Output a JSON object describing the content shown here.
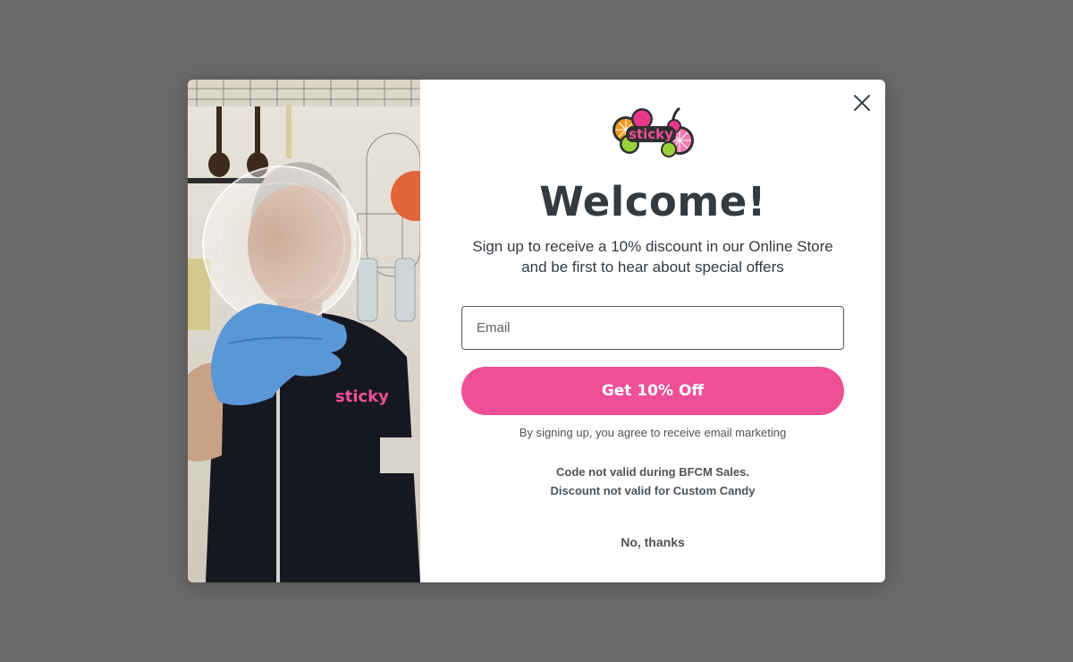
{
  "modal": {
    "logo_text": "sticky",
    "title": "Welcome!",
    "subtitle_line1": "Sign up to receive a 10% discount in our Online Store",
    "subtitle_line2": "and be first to hear about special offers",
    "email_placeholder": "Email",
    "email_value": "",
    "cta_label": "Get 10% Off",
    "consent_text": "By signing up, you agree to receive email marketing",
    "terms_line1": "Code not valid during BFCM Sales.",
    "terms_line2": "Discount not valid for Custom Candy",
    "decline_label": "No, thanks",
    "photo_shirt_text": "sticky",
    "close_icon": "close-icon"
  },
  "colors": {
    "overlay": "#6b6a69",
    "accent": "#ef4f96",
    "text": "#333a40"
  }
}
